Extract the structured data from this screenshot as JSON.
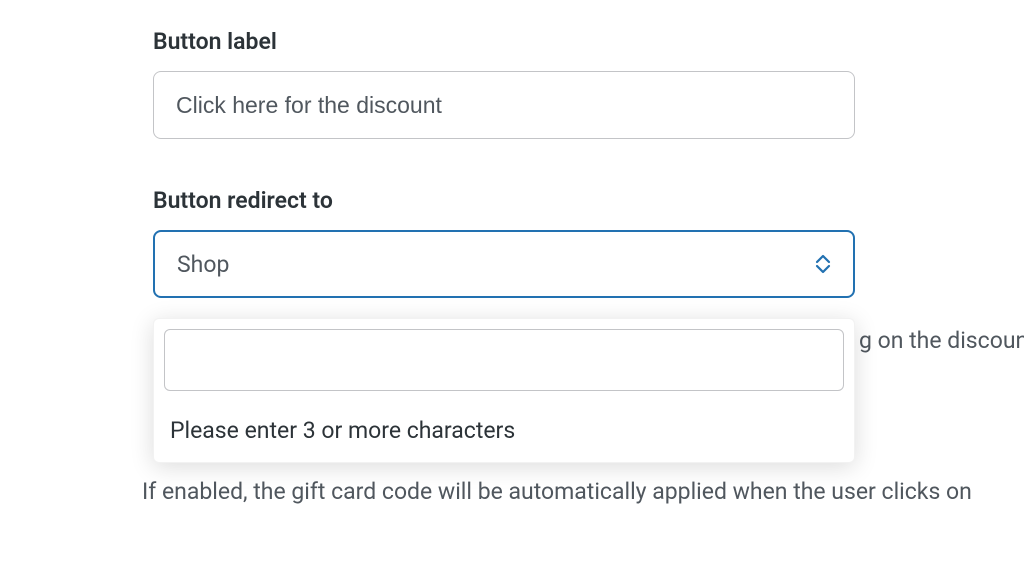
{
  "buttonLabel": {
    "label": "Button label",
    "value": "Click here for the discount"
  },
  "buttonRedirect": {
    "label": "Button redirect to",
    "selected": "Shop",
    "searchValue": "",
    "searchHint": "Please enter 3 or more characters"
  },
  "partialTextRight": "g on the discoun",
  "bottomHint": "If enabled, the gift card code will be automatically applied when the user clicks on"
}
